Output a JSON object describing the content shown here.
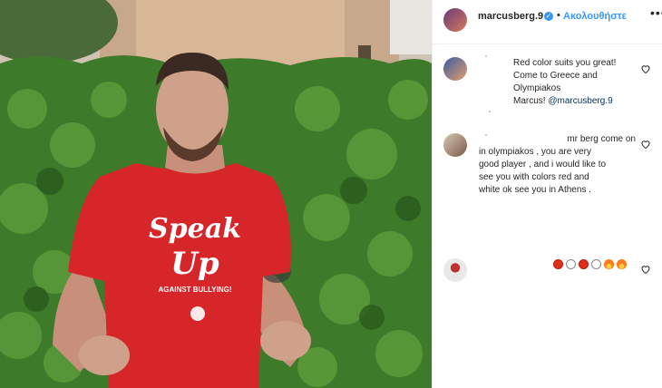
{
  "post": {
    "author": "marcusberg.9",
    "follow_label": "Ακολουθήστε",
    "separator": "•",
    "more_label": "•••"
  },
  "shirt": {
    "line1": "Speak",
    "line2": "Up",
    "line3": "AGAINST BULLYING!"
  },
  "comments": [
    {
      "lines": [
        "Red color suits you great!",
        "Come to Greece and Olympiakos",
        "Marcus! "
      ],
      "mention": "@marcusberg.9"
    },
    {
      "lines": [
        "mr berg come on",
        "in olympiakos , you are very",
        "good player , and i would like to",
        "see you with colors red and",
        "white ok see you in Athens ."
      ]
    },
    {
      "emojis": [
        "red-circle",
        "white-circle",
        "red-circle",
        "white-circle",
        "fire",
        "fire"
      ]
    }
  ],
  "colors": {
    "link": "#3897f0",
    "shirt": "#d6262a",
    "hedge": "#2f6b22"
  }
}
